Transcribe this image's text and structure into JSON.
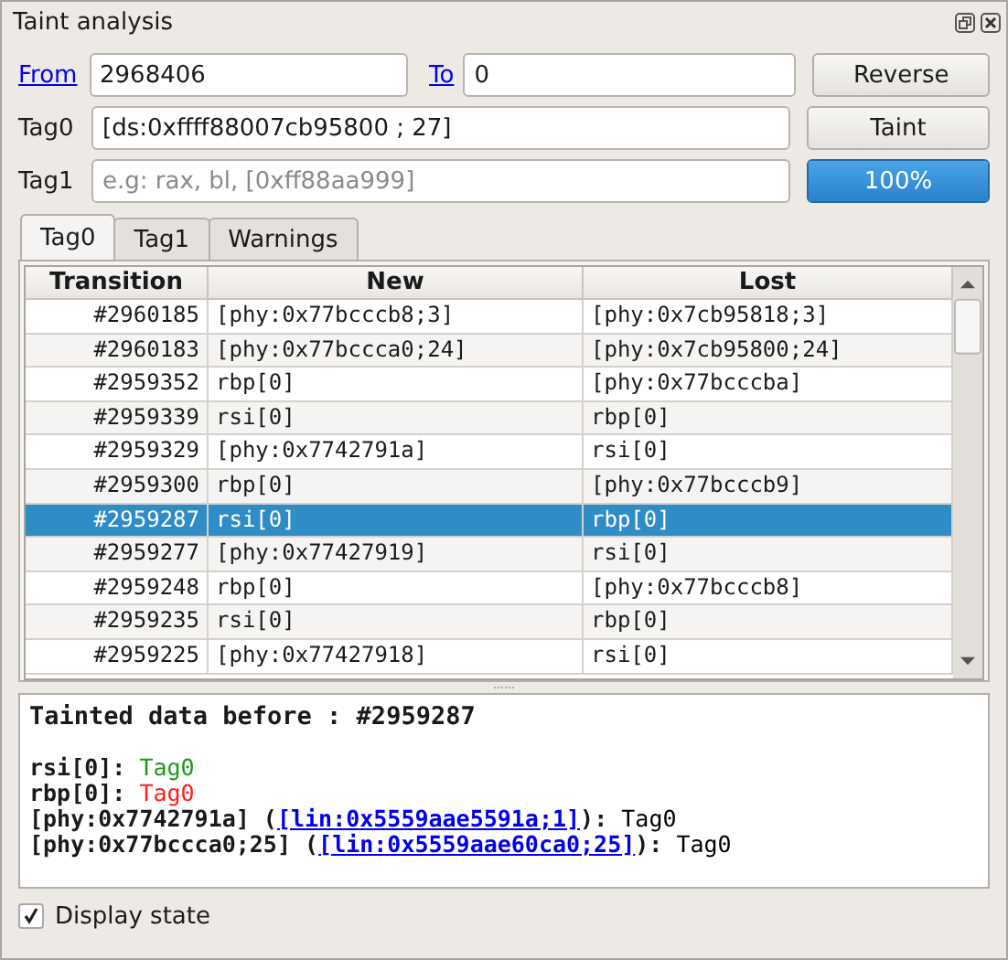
{
  "window": {
    "title": "Taint analysis"
  },
  "range": {
    "from_link": "From",
    "from_value": "2968406",
    "to_link": "To",
    "to_value": "0"
  },
  "buttons": [
    "Reverse",
    "Taint"
  ],
  "tags": [
    {
      "label": "Tag0",
      "value": "[ds:0xffff88007cb95800 ; 27]"
    },
    {
      "label": "Tag1",
      "placeholder": "e.g: rax, bl, [0xff88aa999]"
    }
  ],
  "progress": {
    "text": "100%",
    "level": 1
  },
  "tabs": [
    {
      "label": "Tag0",
      "selected": true
    },
    {
      "label": "Tag1",
      "selected": false
    },
    {
      "label": "Warnings",
      "selected": false
    }
  ],
  "table": {
    "columns": [
      "Transition",
      "New",
      "Lost"
    ],
    "rows": [
      {
        "transition": "#2960185",
        "new": "[phy:0x77bcccb8;3]",
        "lost": "[phy:0x7cb95818;3]",
        "selected": false
      },
      {
        "transition": "#2960183",
        "new": "[phy:0x77bccca0;24]",
        "lost": "[phy:0x7cb95800;24]",
        "selected": false
      },
      {
        "transition": "#2959352",
        "new": "rbp[0]",
        "lost": "[phy:0x77bcccba]",
        "selected": false
      },
      {
        "transition": "#2959339",
        "new": "rsi[0]",
        "lost": "rbp[0]",
        "selected": false
      },
      {
        "transition": "#2959329",
        "new": "[phy:0x7742791a]",
        "lost": "rsi[0]",
        "selected": false
      },
      {
        "transition": "#2959300",
        "new": "rbp[0]",
        "lost": "[phy:0x77bcccb9]",
        "selected": false
      },
      {
        "transition": "#2959287",
        "new": "rsi[0]",
        "lost": "rbp[0]",
        "selected": true
      },
      {
        "transition": "#2959277",
        "new": "[phy:0x77427919]",
        "lost": "rsi[0]",
        "selected": false
      },
      {
        "transition": "#2959248",
        "new": "rbp[0]",
        "lost": "[phy:0x77bcccb8]",
        "selected": false
      },
      {
        "transition": "#2959235",
        "new": "rsi[0]",
        "lost": "rbp[0]",
        "selected": false
      },
      {
        "transition": "#2959225",
        "new": "[phy:0x77427918]",
        "lost": "rsi[0]",
        "selected": false
      }
    ]
  },
  "details": {
    "heading": "Tainted data before : #2959287",
    "lines": [
      {
        "parts": [
          {
            "kind": "bold",
            "text": "rsi[0]:"
          },
          {
            "kind": "tag",
            "text": "Tag0",
            "color": "#1a9a1a"
          }
        ]
      },
      {
        "parts": [
          {
            "kind": "bold",
            "text": "rbp[0]:"
          },
          {
            "kind": "tag",
            "text": "Tag0",
            "color": "#ff2020"
          }
        ]
      },
      {
        "parts": [
          {
            "kind": "bold",
            "text": "[phy:0x7742791a] ("
          },
          {
            "kind": "link",
            "text": "[lin:0x5559aae5591a;1]"
          },
          {
            "kind": "bold",
            "text": "):"
          },
          {
            "kind": "tag",
            "text": "Tag0",
            "color": "#000000"
          }
        ]
      },
      {
        "parts": [
          {
            "kind": "bold",
            "text": "[phy:0x77bccca0;25] ("
          },
          {
            "kind": "link",
            "text": "[lin:0x5559aae60ca0;25]"
          },
          {
            "kind": "bold",
            "text": "):"
          },
          {
            "kind": "tag",
            "text": "Tag0",
            "color": "#000000"
          }
        ]
      }
    ]
  },
  "display_state": {
    "label": "Display state",
    "checked": true
  }
}
